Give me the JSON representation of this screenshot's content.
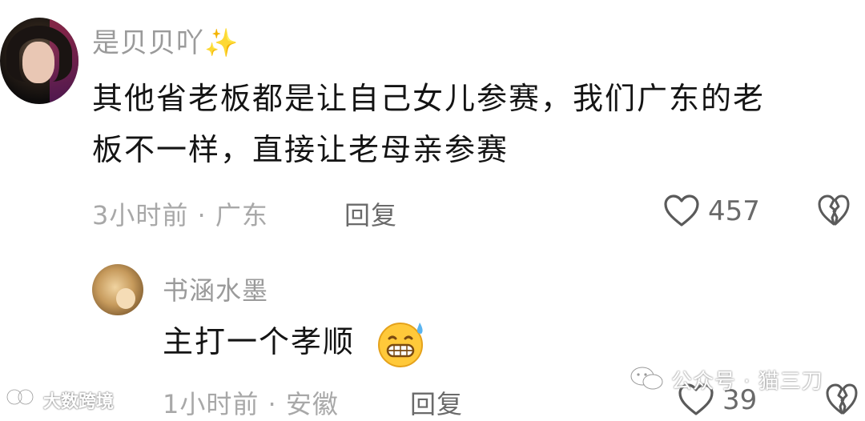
{
  "main_comment": {
    "username": "是贝贝吖✨",
    "text_line1": "其他省老板都是让自己女儿参赛，我们广东的老",
    "text_line2": "板不一样，直接让老母亲参赛",
    "time_location": "3小时前 · 广东",
    "reply_label": "回复",
    "likes": "457"
  },
  "reply_comment": {
    "username": "书涵水墨",
    "text": "主打一个孝顺",
    "time_location": "1小时前 · 安徽",
    "reply_label": "回复",
    "likes": "39"
  },
  "watermarks": {
    "left": "大数跨境",
    "right": "公众号 · 猫三刀"
  },
  "icons": {
    "like": "heart-outline-icon",
    "dislike": "broken-heart-icon",
    "emoji": "grinning-sweat-emoji",
    "wechat": "wechat-icon"
  }
}
